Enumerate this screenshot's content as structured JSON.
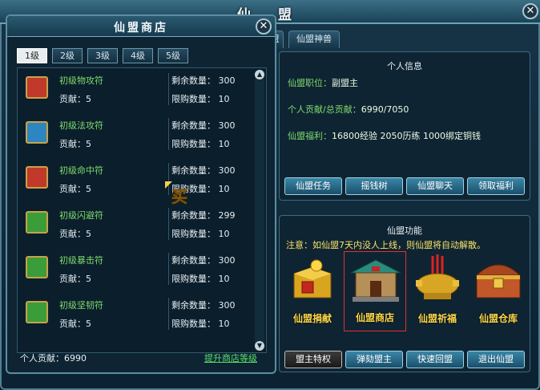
{
  "window": {
    "title": "仙 盟"
  },
  "main_tabs": [
    "盟",
    "仙盟神兽"
  ],
  "personal_info": {
    "title": "个人信息",
    "position": {
      "label": "仙盟职位：",
      "value": "副盟主"
    },
    "contribution": {
      "label": "个人贡献/总贡献：",
      "value": "6990/7050"
    },
    "welfare": {
      "label": "仙盟福利：",
      "value": "16800经验 2050历练 1000绑定铜钱"
    },
    "buttons": [
      "仙盟任务",
      "摇钱树",
      "仙盟聊天",
      "领取福利"
    ]
  },
  "functions": {
    "title": "仙盟功能",
    "notice": "注意：如仙盟7天内没人上线，则仙盟将自动解散。",
    "items": [
      "仙盟捐献",
      "仙盟商店",
      "仙盟祈福",
      "仙盟仓库"
    ],
    "selected": "仙盟商店",
    "buttons": [
      "盟主特权",
      "弹劾盟主",
      "快速回盟",
      "退出仙盟"
    ]
  },
  "shop": {
    "title": "仙盟商店",
    "level_tabs": [
      "1级",
      "2级",
      "3级",
      "4级",
      "5级"
    ],
    "active_tab": "1级",
    "remain_label": "剩余数量：",
    "contrib_label": "贡献：",
    "limit_label": "限购数量：",
    "items": [
      {
        "name": "初级物攻符",
        "contribution": "5",
        "remaining": "300",
        "limit": "10",
        "color": "#c0392b"
      },
      {
        "name": "初级法攻符",
        "contribution": "5",
        "remaining": "300",
        "limit": "10",
        "color": "#2e86c1"
      },
      {
        "name": "初级命中符",
        "contribution": "5",
        "remaining": "300",
        "limit": "10",
        "color": "#c0392b"
      },
      {
        "name": "初级闪避符",
        "contribution": "5",
        "remaining": "299",
        "limit": "10",
        "color": "#3a9d3a"
      },
      {
        "name": "初级暴击符",
        "contribution": "5",
        "remaining": "300",
        "limit": "10",
        "color": "#3a9d3a"
      },
      {
        "name": "初级坚韧符",
        "contribution": "5",
        "remaining": "300",
        "limit": "10",
        "color": "#3a9d3a"
      }
    ],
    "buy_label": "买",
    "personal_contribution": "个人贡献：6990",
    "upgrade_link": "提升商店等级"
  }
}
